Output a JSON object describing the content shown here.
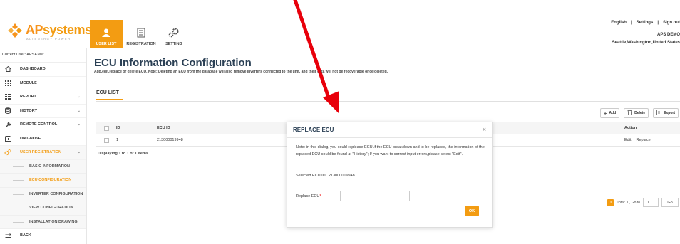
{
  "brand": {
    "name_ap": "AP",
    "name_rest": "systems",
    "tagline": "ALTENERGY POWER",
    "accent_color": "#f39c12"
  },
  "topnav": [
    {
      "label": "USER LIST",
      "icon": "user-list-icon",
      "active": true
    },
    {
      "label": "REGISTRATION",
      "icon": "registration-icon",
      "active": false
    },
    {
      "label": "SETTING",
      "icon": "gear-icon",
      "active": false
    }
  ],
  "toplinks": {
    "language": "English",
    "sep1": "|",
    "settings": "Settings",
    "sep2": "|",
    "signout": "Sign out"
  },
  "userinfo": {
    "name": "APS DEMO",
    "location": "Seattle,Washington,United States"
  },
  "sidebar": {
    "current_user": "Current User: APSATest",
    "items": [
      {
        "label": "DASHBOARD",
        "icon": "dashboard-icon",
        "chevron": ""
      },
      {
        "label": "MODULE",
        "icon": "module-grid-icon",
        "chevron": ""
      },
      {
        "label": "REPORT",
        "icon": "report-icon",
        "chevron": "⌄"
      },
      {
        "label": "HISTORY",
        "icon": "history-icon",
        "chevron": "⌄"
      },
      {
        "label": "REMOTE CONTROL",
        "icon": "wrench-icon",
        "chevron": "⌄"
      },
      {
        "label": "DIAGNOSE",
        "icon": "diagnose-icon",
        "chevron": ""
      },
      {
        "label": "USER REGISTRATION",
        "icon": "gears-icon",
        "chevron": "⌄"
      }
    ],
    "subitems": [
      {
        "label": "BASIC INFORMATION"
      },
      {
        "label": "ECU CONFIGURATION"
      },
      {
        "label": "INVERTER CONFIGURATION"
      },
      {
        "label": "VIEW CONFIGURATION"
      },
      {
        "label": "INSTALLATION DRAWING"
      }
    ],
    "back": {
      "label": "BACK",
      "icon": "back-arrow-icon"
    }
  },
  "main": {
    "title": "ECU Information Configuration",
    "description": "Add,edit,replace or delete ECU. Note: Deleting an ECU from the database will also remove inverters connected to the unit, and their data will not be recoverable once deleted.",
    "section_title": "ECU LIST",
    "toolbar": {
      "add": "Add",
      "delete": "Delete",
      "export": "Export"
    },
    "table": {
      "headers": {
        "id": "ID",
        "ecu_id": "ECU ID",
        "action": "Action"
      },
      "rows": [
        {
          "id": "1",
          "ecu_id": "213000019948",
          "edit": "Edit",
          "replace": "Replace"
        }
      ],
      "footer": "Displaying 1 to 1 of 1 items."
    },
    "pager": {
      "current": "1",
      "total_label": "Total: 1 , Go to",
      "goto_value": "1",
      "go": "Go"
    }
  },
  "modal": {
    "title": "REPLACE ECU",
    "close": "×",
    "note": "Note: in this dialog, you could replease ECU.If the ECU breakdown and to be replaced, the information of the replaced ECU could be found at \"History\"; If you want to correct input errors,please select \"Edit\".",
    "selected_label": "Selected ECU ID",
    "selected_value": "213000019948",
    "replace_label": "Replace ECU",
    "required_mark": "*",
    "ok": "OK"
  }
}
